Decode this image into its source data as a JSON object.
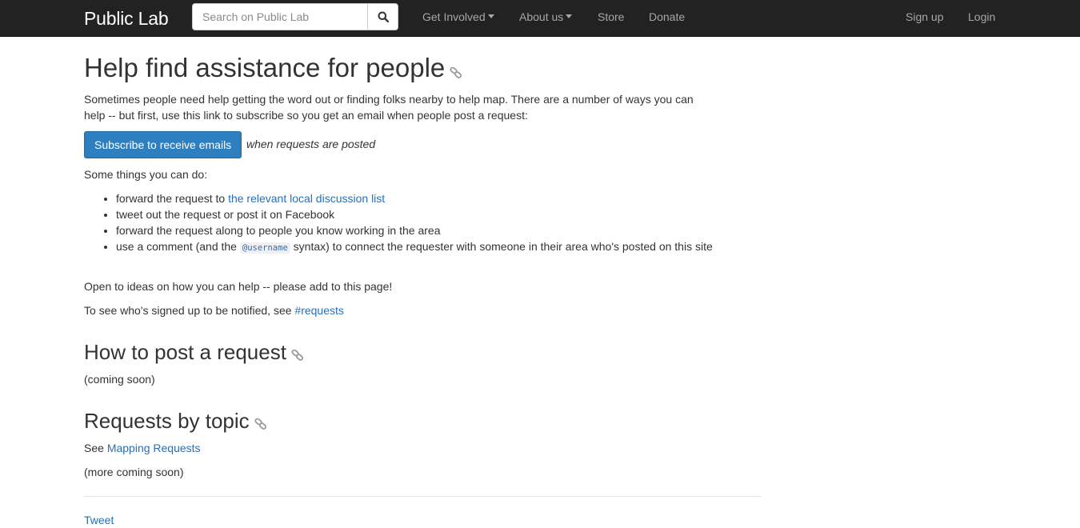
{
  "nav": {
    "brand": "Public Lab",
    "search_placeholder": "Search on Public Lab",
    "get_involved": "Get Involved",
    "about_us": "About us",
    "store": "Store",
    "donate": "Donate",
    "sign_up": "Sign up",
    "login": "Login"
  },
  "page": {
    "title": "Help find assistance for people",
    "intro": "Sometimes people need help getting the word out or finding folks nearby to help map. There are a number of ways you can help -- but first, use this link to subscribe so you get an email when people post a request:",
    "subscribe_button": "Subscribe to receive emails",
    "subscribe_note": "when requests are posted",
    "things_intro": "Some things you can do:",
    "list": {
      "item1_text": "forward the request to ",
      "item1_link": "the relevant local discussion list",
      "item2": "tweet out the request or post it on Facebook",
      "item3": "forward the request along to people you know working in the area",
      "item4_before": "use a comment (and the ",
      "item4_code": "@username",
      "item4_after": " syntax) to connect the requester with someone in their area who's posted on this site"
    },
    "open_ideas": "Open to ideas on how you can help -- please add to this page!",
    "signed_up_text": "To see who's signed up to be notified, see ",
    "signed_up_link": "#requests",
    "section2_title": "How to post a request",
    "coming_soon": "(coming soon)",
    "section3_title": "Requests by topic",
    "see_text": "See ",
    "mapping_requests_link": "Mapping Requests",
    "more_coming_soon": "(more coming soon)",
    "tweet_link": "Tweet"
  },
  "colors": {
    "navbar_bg": "#222222",
    "primary_button": "#2d7fc0",
    "link": "#2a6fb5"
  }
}
